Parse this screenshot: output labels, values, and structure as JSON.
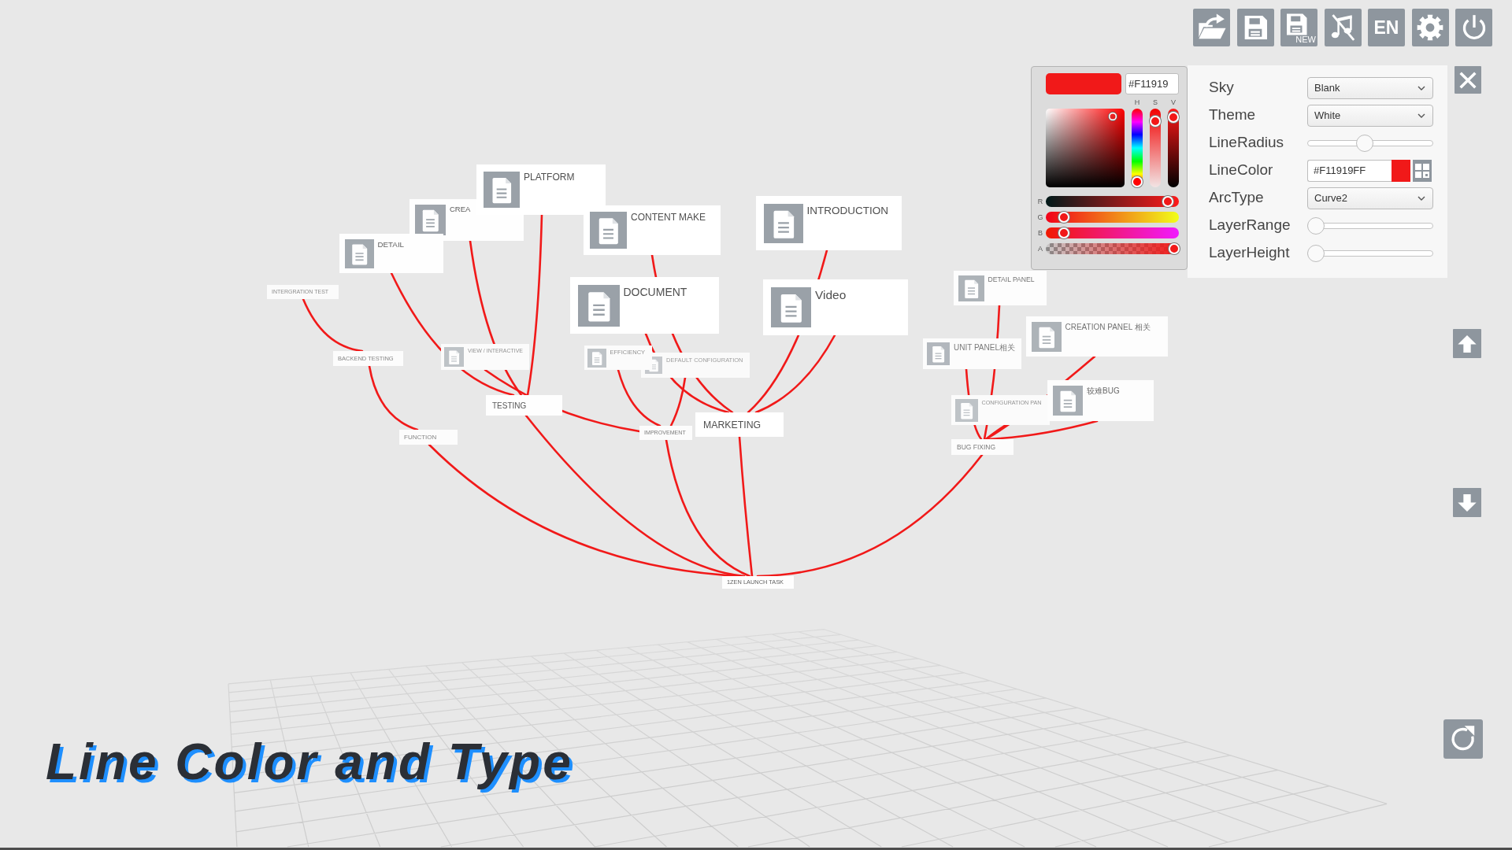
{
  "toolbar": [
    {
      "kind": "open"
    },
    {
      "kind": "save"
    },
    {
      "kind": "save_new",
      "label": "NEW"
    },
    {
      "kind": "sound",
      "muted": true
    },
    {
      "kind": "language",
      "label": "EN"
    },
    {
      "kind": "settings"
    },
    {
      "kind": "power"
    }
  ],
  "color_picker": {
    "color": "#f11919",
    "hex": "#F11919",
    "hsv": [
      {
        "label": "H",
        "level": 0
      },
      {
        "label": "S",
        "level": 0.9
      },
      {
        "label": "V",
        "level": 0.95
      }
    ],
    "rgba": [
      {
        "label": "R",
        "level": 0.95
      },
      {
        "label": "G",
        "level": 0.1
      },
      {
        "label": "B",
        "level": 0.1
      },
      {
        "label": "A",
        "level": 1
      }
    ]
  },
  "settings": [
    {
      "kind": "select",
      "label": "Sky",
      "value": "Blank"
    },
    {
      "kind": "select",
      "label": "Theme",
      "value": "White"
    },
    {
      "kind": "slider",
      "label": "LineRadius",
      "level": 0.45
    },
    {
      "kind": "color",
      "label": "LineColor",
      "value": "#F11919FF"
    },
    {
      "kind": "select",
      "label": "ArcType",
      "value": "Curve2"
    },
    {
      "kind": "slider",
      "label": "LayerRange",
      "level": 0
    },
    {
      "kind": "slider",
      "label": "LayerHeight",
      "level": 0
    }
  ],
  "mind_map": {
    "kind": "label",
    "label": "1ZEN LAUNCH TASK",
    "children": [
      {
        "kind": "label",
        "label": "MARKETING",
        "children": [
          {
            "kind": "document",
            "label": "CONTENT MAKE"
          },
          {
            "kind": "document",
            "label": "DOCUMENT"
          },
          {
            "kind": "document",
            "label": "INTRODUCTION"
          },
          {
            "kind": "document",
            "label": "Video"
          }
        ]
      },
      {
        "kind": "label",
        "label": "IMPROVEMENT",
        "children": [
          {
            "kind": "document",
            "label": "VIEW / INTERACTIVE"
          },
          {
            "kind": "document",
            "label": "EFFICIENCY"
          },
          {
            "kind": "document",
            "label": "DEFAULT CONFIGURATION"
          }
        ]
      },
      {
        "kind": "label",
        "label": "TESTING",
        "children": [
          {
            "kind": "document",
            "label": "PLATFORM"
          },
          {
            "kind": "document",
            "label": "CREA"
          },
          {
            "kind": "document",
            "label": "DETAIL"
          }
        ]
      },
      {
        "kind": "label",
        "label": "FUNCTION",
        "children": [
          {
            "kind": "label",
            "label": "BACKEND TESTING",
            "children": [
              {
                "kind": "label",
                "label": "INTERGRATION TEST"
              }
            ]
          }
        ]
      },
      {
        "kind": "label",
        "label": "BUG FIXING",
        "children": [
          {
            "kind": "document",
            "label": "DETAIL PANEL"
          },
          {
            "kind": "document",
            "label": "UNIT PANEL相关"
          },
          {
            "kind": "document",
            "label": "CONFIGURATION PAN"
          },
          {
            "kind": "document",
            "label": "较难BUG"
          },
          {
            "kind": "document",
            "label": "CREATION PANEL 相关"
          }
        ]
      }
    ]
  },
  "caption": "Line Color and Type"
}
